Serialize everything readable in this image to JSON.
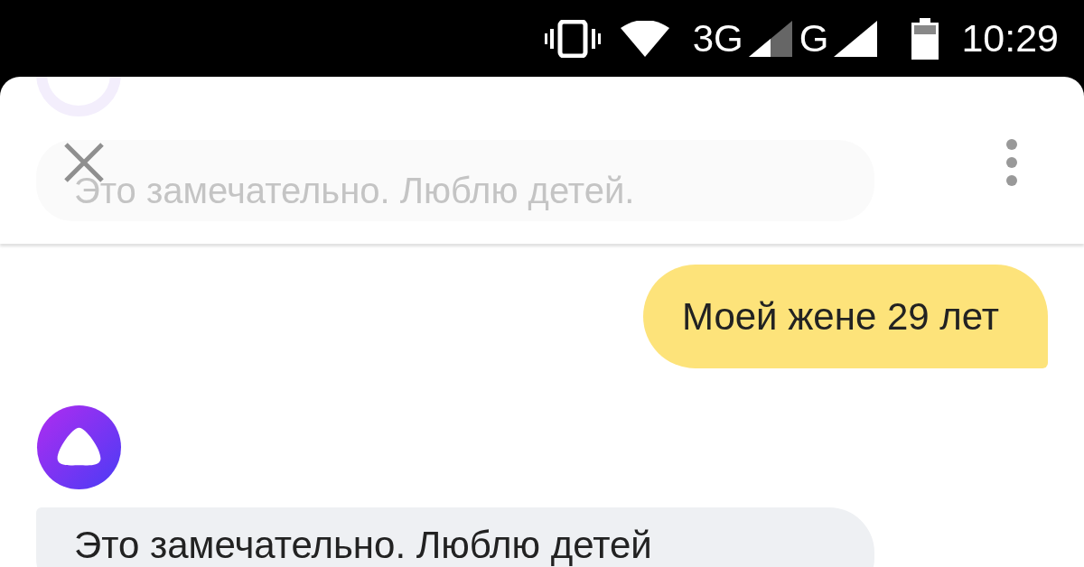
{
  "status_bar": {
    "network_primary": "3G",
    "network_secondary": "G",
    "time": "10:29"
  },
  "header": {
    "ghost_message": "Это замечательно. Люблю детей."
  },
  "messages": [
    {
      "kind": "user",
      "text": "Моей жене 29 лет"
    },
    {
      "kind": "assistant",
      "text": "Это замечательно. Люблю детей"
    }
  ]
}
